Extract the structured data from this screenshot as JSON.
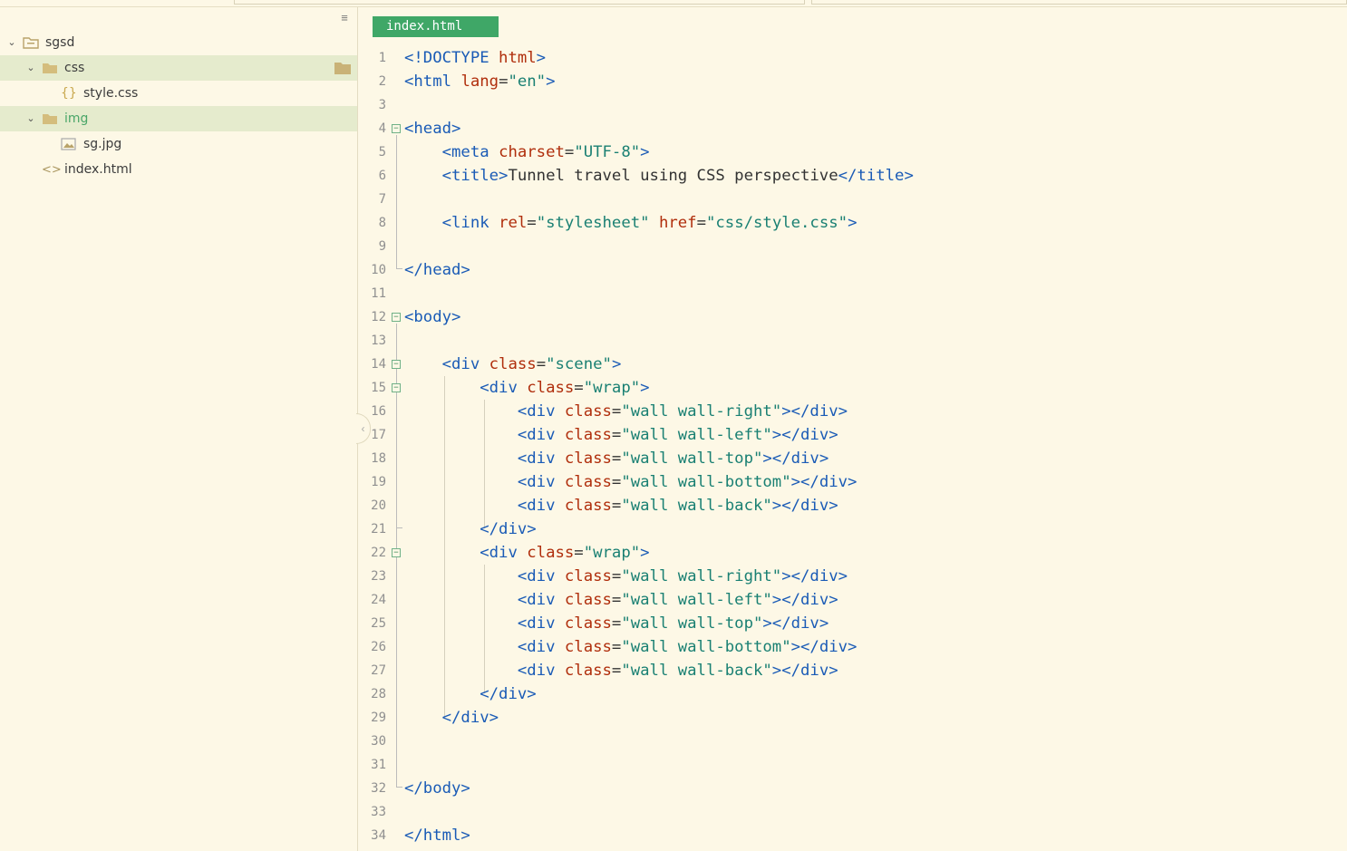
{
  "sidebar": {
    "menu_icon": "hamburger-menu-icon",
    "tree": [
      {
        "label": "sgsd",
        "type": "folder-root",
        "expanded": true
      },
      {
        "label": "css",
        "type": "folder",
        "expanded": true,
        "selected": true
      },
      {
        "label": "style.css",
        "type": "css-file"
      },
      {
        "label": "img",
        "type": "folder",
        "expanded": true,
        "selected": true
      },
      {
        "label": "sg.jpg",
        "type": "image-file"
      },
      {
        "label": "index.html",
        "type": "html-file"
      }
    ]
  },
  "editor": {
    "tab_label": "index.html",
    "lines": [
      {
        "n": "1",
        "parts": [
          [
            "t",
            "<!DOCTYPE "
          ],
          [
            "a",
            "html"
          ],
          [
            "t",
            ">"
          ]
        ]
      },
      {
        "n": "2",
        "parts": [
          [
            "t",
            "<html "
          ],
          [
            "a",
            "lang"
          ],
          [
            "p",
            "="
          ],
          [
            "s",
            "\"en\""
          ],
          [
            "t",
            ">"
          ]
        ]
      },
      {
        "n": "3",
        "parts": []
      },
      {
        "n": "4",
        "fold": true,
        "parts": [
          [
            "t",
            "<head>"
          ]
        ]
      },
      {
        "n": "5",
        "parts": [
          [
            "p",
            "    "
          ],
          [
            "t",
            "<meta "
          ],
          [
            "a",
            "charset"
          ],
          [
            "p",
            "="
          ],
          [
            "s",
            "\"UTF-8\""
          ],
          [
            "t",
            ">"
          ]
        ]
      },
      {
        "n": "6",
        "parts": [
          [
            "p",
            "    "
          ],
          [
            "t",
            "<title>"
          ],
          [
            "p",
            "Tunnel travel using CSS perspective"
          ],
          [
            "t",
            "</title>"
          ]
        ]
      },
      {
        "n": "7",
        "parts": []
      },
      {
        "n": "8",
        "parts": [
          [
            "p",
            "    "
          ],
          [
            "t",
            "<link "
          ],
          [
            "a",
            "rel"
          ],
          [
            "p",
            "="
          ],
          [
            "s",
            "\"stylesheet\""
          ],
          [
            "p",
            " "
          ],
          [
            "a",
            "href"
          ],
          [
            "p",
            "="
          ],
          [
            "s",
            "\"css/style.css\""
          ],
          [
            "t",
            ">"
          ]
        ]
      },
      {
        "n": "9",
        "parts": []
      },
      {
        "n": "10",
        "parts": [
          [
            "t",
            "</head>"
          ]
        ]
      },
      {
        "n": "11",
        "parts": []
      },
      {
        "n": "12",
        "fold": true,
        "parts": [
          [
            "t",
            "<body>"
          ]
        ]
      },
      {
        "n": "13",
        "parts": []
      },
      {
        "n": "14",
        "fold": true,
        "parts": [
          [
            "p",
            "    "
          ],
          [
            "t",
            "<div "
          ],
          [
            "a",
            "class"
          ],
          [
            "p",
            "="
          ],
          [
            "s",
            "\"scene\""
          ],
          [
            "t",
            ">"
          ]
        ]
      },
      {
        "n": "15",
        "fold": true,
        "parts": [
          [
            "p",
            "        "
          ],
          [
            "t",
            "<div "
          ],
          [
            "a",
            "class"
          ],
          [
            "p",
            "="
          ],
          [
            "s",
            "\"wrap\""
          ],
          [
            "t",
            ">"
          ]
        ]
      },
      {
        "n": "16",
        "parts": [
          [
            "p",
            "            "
          ],
          [
            "t",
            "<div "
          ],
          [
            "a",
            "class"
          ],
          [
            "p",
            "="
          ],
          [
            "s",
            "\"wall wall-right\""
          ],
          [
            "t",
            "></div>"
          ]
        ]
      },
      {
        "n": "17",
        "parts": [
          [
            "p",
            "            "
          ],
          [
            "t",
            "<div "
          ],
          [
            "a",
            "class"
          ],
          [
            "p",
            "="
          ],
          [
            "s",
            "\"wall wall-left\""
          ],
          [
            "t",
            "></div>"
          ]
        ]
      },
      {
        "n": "18",
        "parts": [
          [
            "p",
            "            "
          ],
          [
            "t",
            "<div "
          ],
          [
            "a",
            "class"
          ],
          [
            "p",
            "="
          ],
          [
            "s",
            "\"wall wall-top\""
          ],
          [
            "t",
            "></div>"
          ]
        ]
      },
      {
        "n": "19",
        "parts": [
          [
            "p",
            "            "
          ],
          [
            "t",
            "<div "
          ],
          [
            "a",
            "class"
          ],
          [
            "p",
            "="
          ],
          [
            "s",
            "\"wall wall-bottom\""
          ],
          [
            "t",
            "></div>"
          ]
        ]
      },
      {
        "n": "20",
        "parts": [
          [
            "p",
            "            "
          ],
          [
            "t",
            "<div "
          ],
          [
            "a",
            "class"
          ],
          [
            "p",
            "="
          ],
          [
            "s",
            "\"wall wall-back\""
          ],
          [
            "t",
            "></div>"
          ]
        ]
      },
      {
        "n": "21",
        "parts": [
          [
            "p",
            "        "
          ],
          [
            "t",
            "</div>"
          ]
        ]
      },
      {
        "n": "22",
        "fold": true,
        "parts": [
          [
            "p",
            "        "
          ],
          [
            "t",
            "<div "
          ],
          [
            "a",
            "class"
          ],
          [
            "p",
            "="
          ],
          [
            "s",
            "\"wrap\""
          ],
          [
            "t",
            ">"
          ]
        ]
      },
      {
        "n": "23",
        "parts": [
          [
            "p",
            "            "
          ],
          [
            "t",
            "<div "
          ],
          [
            "a",
            "class"
          ],
          [
            "p",
            "="
          ],
          [
            "s",
            "\"wall wall-right\""
          ],
          [
            "t",
            "></div>"
          ]
        ]
      },
      {
        "n": "24",
        "parts": [
          [
            "p",
            "            "
          ],
          [
            "t",
            "<div "
          ],
          [
            "a",
            "class"
          ],
          [
            "p",
            "="
          ],
          [
            "s",
            "\"wall wall-left\""
          ],
          [
            "t",
            "></div>"
          ]
        ]
      },
      {
        "n": "25",
        "parts": [
          [
            "p",
            "            "
          ],
          [
            "t",
            "<div "
          ],
          [
            "a",
            "class"
          ],
          [
            "p",
            "="
          ],
          [
            "s",
            "\"wall wall-top\""
          ],
          [
            "t",
            "></div>"
          ]
        ]
      },
      {
        "n": "26",
        "parts": [
          [
            "p",
            "            "
          ],
          [
            "t",
            "<div "
          ],
          [
            "a",
            "class"
          ],
          [
            "p",
            "="
          ],
          [
            "s",
            "\"wall wall-bottom\""
          ],
          [
            "t",
            "></div>"
          ]
        ]
      },
      {
        "n": "27",
        "parts": [
          [
            "p",
            "            "
          ],
          [
            "t",
            "<div "
          ],
          [
            "a",
            "class"
          ],
          [
            "p",
            "="
          ],
          [
            "s",
            "\"wall wall-back\""
          ],
          [
            "t",
            "></div>"
          ]
        ]
      },
      {
        "n": "28",
        "parts": [
          [
            "p",
            "        "
          ],
          [
            "t",
            "</div>"
          ]
        ]
      },
      {
        "n": "29",
        "parts": [
          [
            "p",
            "    "
          ],
          [
            "t",
            "</div>"
          ]
        ]
      },
      {
        "n": "30",
        "parts": []
      },
      {
        "n": "31",
        "parts": []
      },
      {
        "n": "32",
        "parts": [
          [
            "t",
            "</body>"
          ]
        ]
      },
      {
        "n": "33",
        "parts": []
      },
      {
        "n": "34",
        "parts": [
          [
            "t",
            "</html>"
          ]
        ]
      }
    ]
  },
  "colors": {
    "background": "#fdf8e6",
    "selected_row": "#e5ebcd",
    "tab": "#3fa767",
    "tag": "#1a5bb6",
    "attribute": "#b02e0c",
    "string": "#1a8073",
    "folder": "#c8b26e"
  }
}
